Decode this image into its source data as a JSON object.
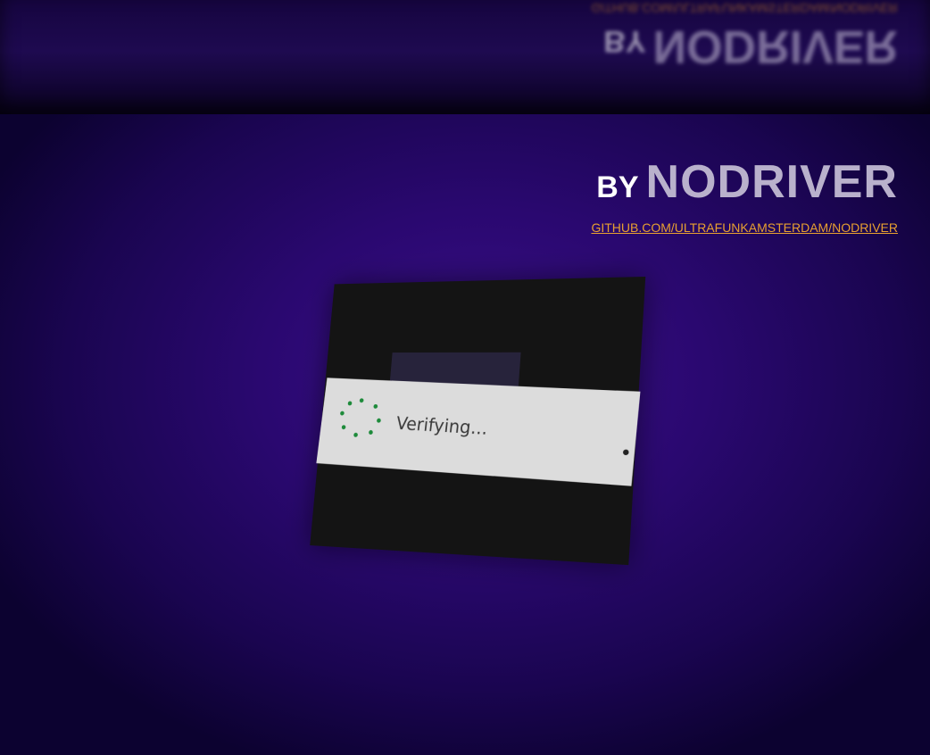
{
  "branding": {
    "by_label": "BY",
    "name": "NODRIVER",
    "link": "GITHUB.COM/ULTRAFUNKAMSTERDAM/NODRIVER"
  },
  "captcha_widget": {
    "status_text": "Verifying..."
  },
  "colors": {
    "background": "#2a0870",
    "name_text": "#b9b1cc",
    "link_text": "#e8a030",
    "spinner": "#1d8a3a"
  },
  "icons": {
    "spinner": "loading-spinner-icon"
  }
}
